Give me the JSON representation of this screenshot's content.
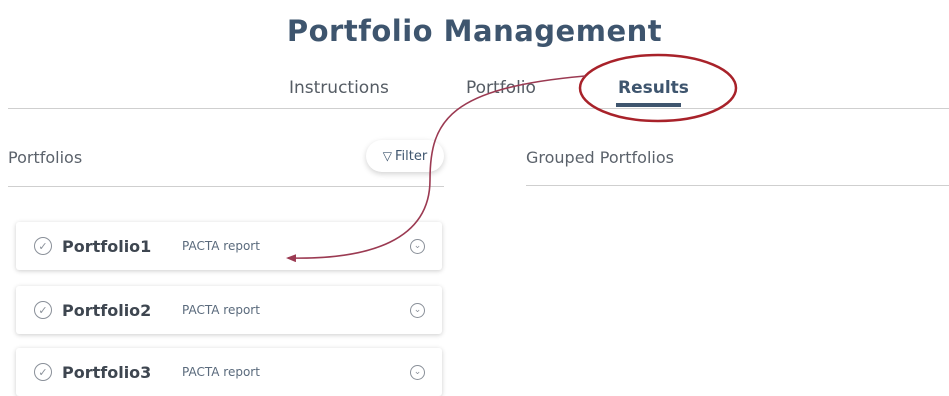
{
  "page": {
    "title": "Portfolio Management"
  },
  "tabs": [
    {
      "label": "Instructions"
    },
    {
      "label": "Portfolio"
    },
    {
      "label": "Results",
      "active": true
    }
  ],
  "portfolios_section": {
    "label": "Portfolios",
    "filter_label": "Filter"
  },
  "grouped_section": {
    "label": "Grouped Portfolios"
  },
  "portfolio_list": [
    {
      "name": "Portfolio1",
      "report": "PACTA report"
    },
    {
      "name": "Portfolio2",
      "report": "PACTA report"
    },
    {
      "name": "Portfolio3",
      "report": "PACTA report"
    }
  ],
  "annotation": {
    "circle_color": "#a8222a",
    "arrow_color": "#9b3a52"
  },
  "icons": {
    "filter": "filter-icon",
    "check": "check-circle-icon",
    "expand": "chevron-down-circle-icon"
  }
}
